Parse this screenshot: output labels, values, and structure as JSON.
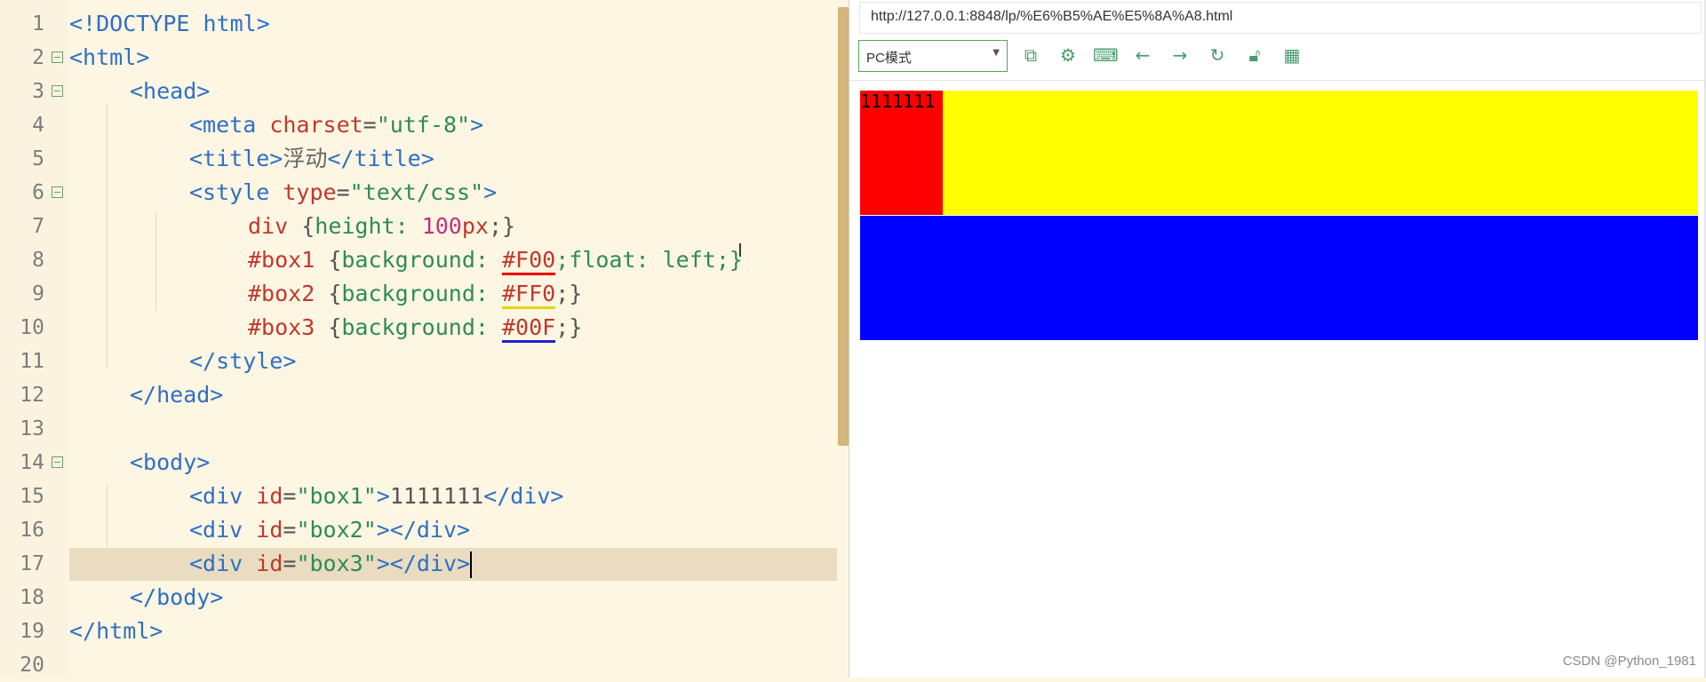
{
  "editor": {
    "lines": [
      {
        "n": "1"
      },
      {
        "n": "2"
      },
      {
        "n": "3"
      },
      {
        "n": "4"
      },
      {
        "n": "5"
      },
      {
        "n": "6"
      },
      {
        "n": "7"
      },
      {
        "n": "8"
      },
      {
        "n": "9"
      },
      {
        "n": "10"
      },
      {
        "n": "11"
      },
      {
        "n": "12"
      },
      {
        "n": "13"
      },
      {
        "n": "14"
      },
      {
        "n": "15"
      },
      {
        "n": "16"
      },
      {
        "n": "17"
      },
      {
        "n": "18"
      },
      {
        "n": "19"
      },
      {
        "n": "20"
      }
    ],
    "code": {
      "l1": "<!DOCTYPE html>",
      "l2": "<html>",
      "l3": "<head>",
      "l4_tag": "<meta ",
      "l4_attr": "charset",
      "l4_eq": "=",
      "l4_val": "\"utf-8\"",
      "l4_end": ">",
      "l5_open": "<title>",
      "l5_text": "浮动",
      "l5_close": "</title>",
      "l6_tag": "<style ",
      "l6_attr": "type",
      "l6_eq": "=",
      "l6_val": "\"text/css\"",
      "l6_end": ">",
      "l7_sel": "div ",
      "l7_b1": "{",
      "l7_prop": "height: ",
      "l7_num": "100",
      "l7_unit": "px",
      "l7_b2": ";}",
      "l8_sel": "#box1 ",
      "l8_b1": "{",
      "l8_prop": "background: ",
      "l8_val": "#F00",
      "l8_rest": ";float: left;}",
      "l9_sel": "#box2 ",
      "l9_b1": "{",
      "l9_prop": "background: ",
      "l9_val": "#FF0",
      "l9_rest": ";}",
      "l10_sel": "#box3 ",
      "l10_b1": "{",
      "l10_prop": "background: ",
      "l10_val": "#00F",
      "l10_rest": ";}",
      "l11": "</style>",
      "l12": "</head>",
      "l14": "<body>",
      "l15_tag": "<div ",
      "l15_attr": "id",
      "l15_eq": "=",
      "l15_val": "\"box1\"",
      "l15_gt": ">",
      "l15_text": "1111111",
      "l15_close": "</div>",
      "l16_tag": "<div ",
      "l16_attr": "id",
      "l16_eq": "=",
      "l16_val": "\"box2\"",
      "l16_close": "></div>",
      "l17_tag": "<div ",
      "l17_attr": "id",
      "l17_eq": "=",
      "l17_val": "\"box3\"",
      "l17_close": "></div>",
      "l18": "</body>",
      "l19": "</html>"
    }
  },
  "preview": {
    "url": "http://127.0.0.1:8848/lp/%E6%B5%AE%E5%8A%A8.html",
    "mode": "PC模式",
    "box1_text": "1111111",
    "colors": {
      "box1": "#FF0000",
      "box2": "#FFFF00",
      "box3": "#0000FF"
    },
    "toolbar_icons": [
      "screenshot-icon",
      "settings-icon",
      "terminal-icon",
      "back-arrow-icon",
      "forward-arrow-icon",
      "refresh-icon",
      "lock-icon",
      "qrcode-icon"
    ]
  },
  "watermark": "CSDN @Python_1981"
}
